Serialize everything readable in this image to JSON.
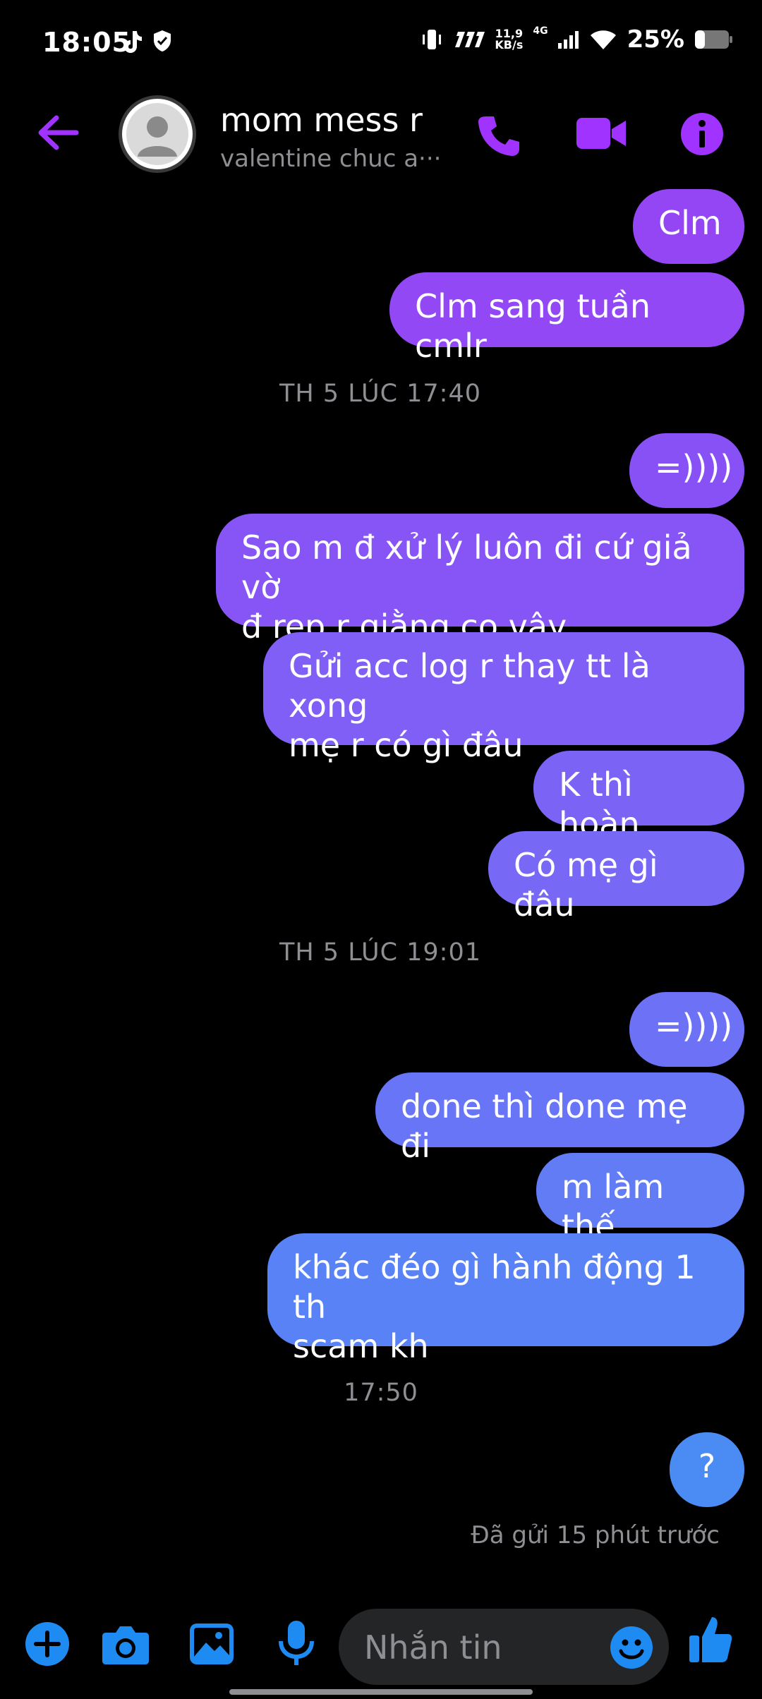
{
  "status_bar": {
    "time": "18:05",
    "net_speed_value": "11,9",
    "net_speed_unit": "KB/s",
    "network": "4G",
    "battery": "25%"
  },
  "header": {
    "title": "mom mess r",
    "subtitle": "valentine chuc a···"
  },
  "messages": [
    {
      "text": "Clm",
      "color": "#9446f4"
    },
    {
      "text": "Clm sang tuần cmlr",
      "color": "#9249f5"
    },
    {
      "timestamp": "TH 5 LÚC 17:40"
    },
    {
      "text": "=))))",
      "color": "#8851f6"
    },
    {
      "text": "Sao m đ xử lý luôn đi cứ giả vờ\nđ rep r giằng co vậy",
      "color": "#8755f6"
    },
    {
      "text": "Gửi acc log r thay tt là xong\nmẹ r có gì đâu",
      "color": "#7f5ff6"
    },
    {
      "text": "K thì hoàn",
      "color": "#7b63f6"
    },
    {
      "text": "Có mẹ gì đâu",
      "color": "#7768f6"
    },
    {
      "timestamp": "TH 5 LÚC 19:01"
    },
    {
      "text": "=))))",
      "color": "#6c71f6"
    },
    {
      "text": "done thì done mẹ đi",
      "color": "#6875f6"
    },
    {
      "text": "m làm thế",
      "color": "#627cf6"
    },
    {
      "text": "khác đéo gì hành động 1 th\nscam kh",
      "color": "#5882f5"
    },
    {
      "timestamp": "17:50"
    },
    {
      "text": "?",
      "color": "#4a8cf3"
    }
  ],
  "sent_status": "Đã gửi 15 phút trước",
  "input": {
    "placeholder": "Nhắn tin"
  },
  "colors": {
    "accent": "#a033ff",
    "input_icons": "#1e8bf2"
  },
  "icons": [
    "tiktok-icon",
    "shield-icon",
    "vibrate-icon",
    "data-icon",
    "signal-icon",
    "wifi-icon",
    "battery-icon",
    "back-arrow-icon",
    "phone-icon",
    "video-icon",
    "info-icon",
    "plus-icon",
    "camera-icon",
    "image-icon",
    "mic-icon",
    "emoji-icon",
    "thumbs-up-icon"
  ]
}
